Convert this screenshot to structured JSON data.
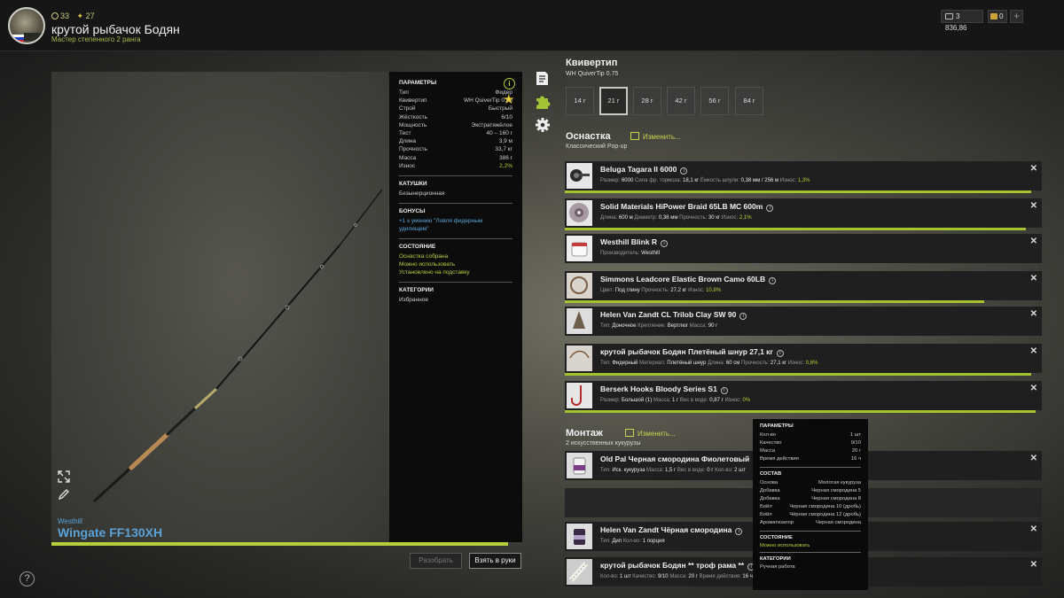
{
  "player": {
    "level_icon": "circle-icon",
    "level": "33",
    "stars": "27",
    "name": "крутой рыбачок Бодян",
    "rank": "Мастер степенного 2 ранга"
  },
  "currency": {
    "silver": "3 836,86",
    "gold": "0",
    "plus": "+"
  },
  "rod": {
    "brand": "Westhill",
    "model": "Wingate FF130XH",
    "progress": 0.97,
    "params_title": "ПАРАМЕТРЫ",
    "params": [
      {
        "label": "Тип",
        "value": "Фидер"
      },
      {
        "label": "Квивертип",
        "value": "WH QuiverTip 0.75"
      },
      {
        "label": "Строй",
        "value": "Быстрый"
      },
      {
        "label": "Жёсткость",
        "value": "6/10"
      },
      {
        "label": "Мощность",
        "value": "Экстратяжёлое"
      },
      {
        "label": "Тест",
        "value": "40 – 160 г"
      },
      {
        "label": "Длина",
        "value": "3,9 м"
      },
      {
        "label": "Прочность",
        "value": "33,7 кг"
      },
      {
        "label": "Масса",
        "value": "386 г"
      },
      {
        "label": "Износ",
        "value": "2,2%"
      }
    ],
    "reels_title": "КАТУШКИ",
    "reels_value": "Безынерционная",
    "bonus_title": "БОНУСЫ",
    "bonus_value": "+1 к умению \"Ловля фидерным удилищем\"",
    "state_title": "СОСТОЯНИЕ",
    "state_lines": [
      "Оснастка собрана",
      "Можно использовать",
      "Установлено на подставку"
    ],
    "cat_title": "КАТЕГОРИИ",
    "cat_value": "Избранное"
  },
  "buttons": {
    "disassemble": "Разобрать",
    "take": "Взять в руки",
    "help": "?"
  },
  "quivertip": {
    "title": "Квивертип",
    "subtitle": "WH QuiverTip 0.75",
    "options": [
      "14 г",
      "21 г",
      "28 г",
      "42 г",
      "56 г",
      "84 г"
    ],
    "selected": "21 г"
  },
  "rig": {
    "title": "Оснастка",
    "edit": "Изменить...",
    "subtitle": "Классический Pop-up",
    "items": [
      {
        "name": "Beluga Tagara II 6000",
        "details": [
          [
            "Размер:",
            "6000"
          ],
          [
            "Сила фр. тормоза:",
            "18,1 кг"
          ],
          [
            "Ёмкость шпули:",
            "0,38 мм / 256 м"
          ],
          [
            "Износ:",
            "1,3%"
          ]
        ],
        "wear": 0.99
      },
      {
        "name": "Solid Materials HiPower Braid 65LB MC 600m",
        "details": [
          [
            "Длина:",
            "600 м"
          ],
          [
            "Диаметр:",
            "0,38 мм"
          ],
          [
            "Прочность:",
            "30 кг"
          ],
          [
            "Износ:",
            "2,1%"
          ]
        ],
        "wear": 0.98
      },
      {
        "name": "Westhill Blink R",
        "details": [
          [
            "Производитель:",
            "Westhill"
          ]
        ],
        "wear": null
      },
      {
        "name": "Simmons Leadcore Elastic Brown Camo 60LB",
        "details": [
          [
            "Цвет:",
            "Под глину"
          ],
          [
            "Прочность:",
            "27,2 кг"
          ],
          [
            "Износ:",
            "10,8%"
          ]
        ],
        "wear": 0.89
      },
      {
        "name": "Helen Van Zandt CL Trilob Clay SW 90",
        "details": [
          [
            "Тип:",
            "Доночное"
          ],
          [
            "Крепление:",
            "Вертлюг"
          ],
          [
            "Масса:",
            "90 г"
          ]
        ],
        "wear": null
      },
      {
        "name": "крутой рыбачок Бодян Плетёный шнур 27,1 кг",
        "details": [
          [
            "Тип:",
            "Фидерный"
          ],
          [
            "Материал:",
            "Плетёный шнур"
          ],
          [
            "Длина:",
            "60 см"
          ],
          [
            "Прочность:",
            "27,1 кг"
          ],
          [
            "Износ:",
            "0,6%"
          ]
        ],
        "wear": 0.99
      },
      {
        "name": "Berserk Hooks Bloody Series S1",
        "details": [
          [
            "Размер:",
            "Большой (1)"
          ],
          [
            "Масса:",
            "1 г"
          ],
          [
            "Вес в воде:",
            "0,87 г"
          ],
          [
            "Износ:",
            "0%"
          ]
        ],
        "wear": 1.0
      }
    ]
  },
  "mount": {
    "title": "Монтаж",
    "edit": "Изменить...",
    "subtitle": "2 искусственных кукурузы",
    "items": [
      {
        "name": "Old Pal Черная смородина Фиолетовый",
        "details": [
          [
            "Тип:",
            "Иск. кукуруза"
          ],
          [
            "Масса:",
            "1,5 г"
          ],
          [
            "Вес в воде:",
            "0 г"
          ],
          [
            "Кол-во:",
            "2 шт"
          ]
        ]
      },
      {
        "name": "Helen Van Zandt Чёрная смородина",
        "details": [
          [
            "Тип:",
            "Дип"
          ],
          [
            "Кол-во:",
            "1 порция"
          ]
        ]
      },
      {
        "name": "крутой рыбачок Бодян ** троф рама **",
        "details": [
          [
            "Кол-во:",
            "1 шт"
          ],
          [
            "Качество:",
            "9/10"
          ],
          [
            "Масса:",
            "20 г"
          ],
          [
            "Время действия:",
            "16 ч"
          ]
        ]
      }
    ]
  },
  "tooltip": {
    "params_title": "ПАРАМЕТРЫ",
    "params": [
      [
        "Кол-во",
        "1 шт"
      ],
      [
        "Качество",
        "9/10"
      ],
      [
        "Масса",
        "20 г"
      ],
      [
        "Время действия",
        "16 ч"
      ]
    ],
    "comp_title": "СОСТАВ",
    "comp": [
      [
        "Основа",
        "Молотая кукуруза"
      ],
      [
        "Добавка",
        "Черная смородина 5"
      ],
      [
        "Добавка",
        "Черная смородина 8"
      ],
      [
        "Бойл",
        "Черная смородина 10 (дробь)"
      ],
      [
        "Бойл",
        "Чёрная смородина 12 (дробь)"
      ],
      [
        "Ароматизатор",
        "Черная смородина"
      ]
    ],
    "state_title": "СОСТОЯНИЕ",
    "state": "Можно использовать",
    "cat_title": "КАТЕГОРИИ",
    "cat": "Ручная работа"
  },
  "colors": {
    "accent": "#b6cf3a",
    "link": "#5aa3d8",
    "star": "#e3c83b"
  }
}
